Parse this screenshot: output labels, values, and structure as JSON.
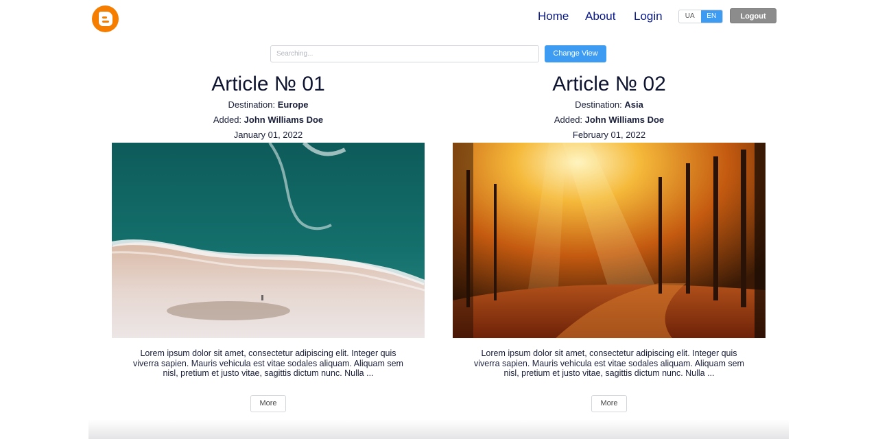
{
  "header": {
    "logo_icon": "blogger-logo-icon",
    "nav": [
      {
        "label": "Home"
      },
      {
        "label": "About"
      },
      {
        "label": "Login"
      }
    ],
    "languages": [
      {
        "code": "UA",
        "active": false
      },
      {
        "code": "EN",
        "active": true
      }
    ],
    "logout_label": "Logout"
  },
  "toolbar": {
    "search_placeholder": "Searching...",
    "search_value": "",
    "change_view_label": "Change View"
  },
  "articles": [
    {
      "title": "Article № 01",
      "destination_label": "Destination:",
      "destination": "Europe",
      "added_label": "Added:",
      "author": "John Williams Doe",
      "date": "January 01, 2022",
      "excerpt": "Lorem ipsum dolor sit amet, consectetur adipiscing elit. Integer quis viverra sapien. Mauris vehicula est vitae sodales aliquam. Aliquam sem nisl, pretium et justo vitae, sagittis dictum nunc. Nulla ...",
      "more_label": "More"
    },
    {
      "title": "Article № 02",
      "destination_label": "Destination:",
      "destination": "Asia",
      "added_label": "Added:",
      "author": "John Williams Doe",
      "date": "February 01, 2022",
      "excerpt": "Lorem ipsum dolor sit amet, consectetur adipiscing elit. Integer quis viverra sapien. Mauris vehicula est vitae sodales aliquam. Aliquam sem nisl, pretium et justo vitae, sagittis dictum nunc. Nulla ...",
      "more_label": "More"
    }
  ],
  "colors": {
    "brand": "#f57d00",
    "nav_link": "#0a1a8c",
    "accent": "#3d9bf2",
    "logout": "#8c8c8c"
  }
}
